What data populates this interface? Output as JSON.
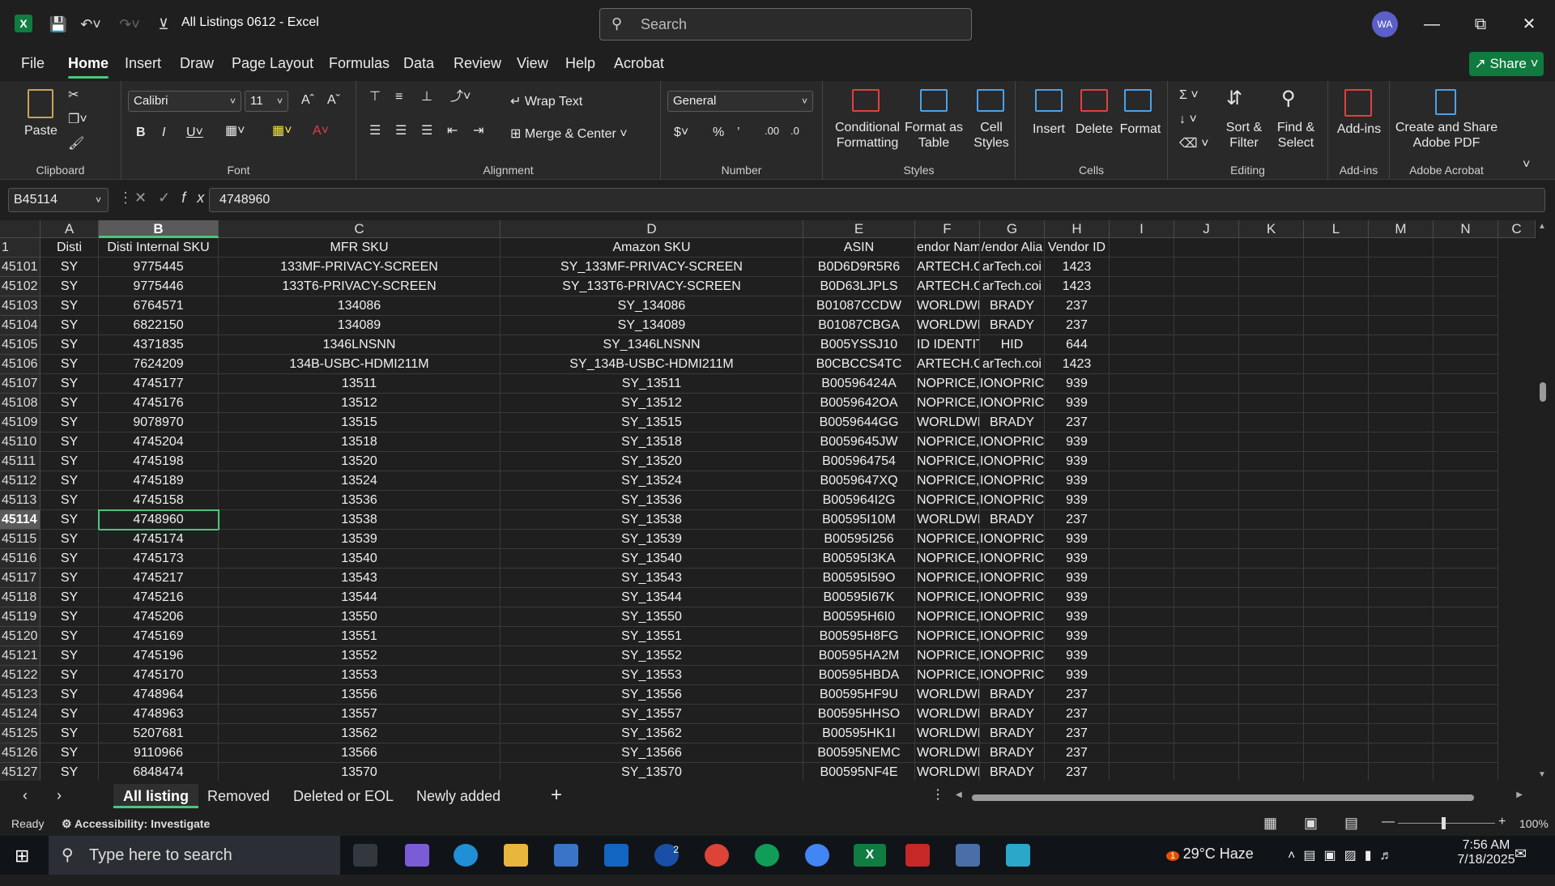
{
  "app": {
    "title": "All Listings 0612  -  Excel",
    "avatar_initials": "WA"
  },
  "search": {
    "placeholder": "Search"
  },
  "menu": {
    "items": [
      "File",
      "Home",
      "Insert",
      "Draw",
      "Page Layout",
      "Formulas",
      "Data",
      "Review",
      "View",
      "Help",
      "Acrobat"
    ],
    "active": "Home",
    "share": "Share"
  },
  "ribbon": {
    "clipboard": {
      "label": "Clipboard",
      "paste": "Paste"
    },
    "font": {
      "label": "Font",
      "name": "Calibri",
      "size": "11"
    },
    "alignment": {
      "label": "Alignment",
      "wrap": "Wrap Text",
      "merge": "Merge & Center"
    },
    "number": {
      "label": "Number",
      "format": "General"
    },
    "styles": {
      "label": "Styles",
      "conditional": "Conditional\nFormatting",
      "format_table": "Format as\nTable",
      "cell_styles": "Cell\nStyles"
    },
    "cells": {
      "label": "Cells",
      "insert": "Insert",
      "delete": "Delete",
      "format": "Format"
    },
    "editing": {
      "label": "Editing",
      "sort": "Sort &\nFilter",
      "find": "Find &\nSelect"
    },
    "addins": {
      "label": "Add-ins",
      "addins": "Add-ins"
    },
    "acrobat": {
      "label": "Adobe Acrobat",
      "create": "Create and Share\nAdobe PDF"
    }
  },
  "formula": {
    "namebox": "B45114",
    "value": "4748960"
  },
  "columns": [
    "A",
    "B",
    "C",
    "D",
    "E",
    "F",
    "G",
    "H",
    "I",
    "J",
    "K",
    "L",
    "M",
    "N",
    "C"
  ],
  "header_row": {
    "num": "1",
    "cells": [
      "Disti",
      "Disti Internal SKU",
      "MFR SKU",
      "Amazon SKU",
      "ASIN",
      "endor Nam",
      "/endor Alia",
      "Vendor ID"
    ]
  },
  "rows": [
    [
      "45101",
      "SY",
      "9775445",
      "133MF-PRIVACY-SCREEN",
      "SY_133MF-PRIVACY-SCREEN",
      "B0D6D9R5R6",
      "ARTECH.CC",
      "arTech.coi",
      "1423"
    ],
    [
      "45102",
      "SY",
      "9775446",
      "133T6-PRIVACY-SCREEN",
      "SY_133T6-PRIVACY-SCREEN",
      "B0D63LJPLS",
      "ARTECH.CC",
      "arTech.coi",
      "1423"
    ],
    [
      "45103",
      "SY",
      "6764571",
      "134086",
      "SY_134086",
      "B01087CCDW",
      "WORLDWII",
      "BRADY",
      "237"
    ],
    [
      "45104",
      "SY",
      "6822150",
      "134089",
      "SY_134089",
      "B01087CBGA",
      "WORLDWII",
      "BRADY",
      "237"
    ],
    [
      "45105",
      "SY",
      "4371835",
      "1346LNSNN",
      "SY_1346LNSNN",
      "B005YSSJ10",
      "ID IDENTIT",
      "HID",
      "644"
    ],
    [
      "45106",
      "SY",
      "7624209",
      "134B-USBC-HDMI211M",
      "SY_134B-USBC-HDMI211M",
      "B0CBCCS4TC",
      "ARTECH.CC",
      "arTech.coi",
      "1423"
    ],
    [
      "45107",
      "SY",
      "4745177",
      "13511",
      "SY_13511",
      "B00596424A",
      "NOPRICE, I",
      "IONOPRIC",
      "939"
    ],
    [
      "45108",
      "SY",
      "4745176",
      "13512",
      "SY_13512",
      "B0059642OA",
      "NOPRICE, I",
      "IONOPRIC",
      "939"
    ],
    [
      "45109",
      "SY",
      "9078970",
      "13515",
      "SY_13515",
      "B0059644GG",
      "WORLDWII",
      "BRADY",
      "237"
    ],
    [
      "45110",
      "SY",
      "4745204",
      "13518",
      "SY_13518",
      "B0059645JW",
      "NOPRICE, I",
      "IONOPRIC",
      "939"
    ],
    [
      "45111",
      "SY",
      "4745198",
      "13520",
      "SY_13520",
      "B005964754",
      "NOPRICE, I",
      "IONOPRIC",
      "939"
    ],
    [
      "45112",
      "SY",
      "4745189",
      "13524",
      "SY_13524",
      "B0059647XQ",
      "NOPRICE, I",
      "IONOPRIC",
      "939"
    ],
    [
      "45113",
      "SY",
      "4745158",
      "13536",
      "SY_13536",
      "B005964I2G",
      "NOPRICE, I",
      "IONOPRIC",
      "939"
    ],
    [
      "45114",
      "SY",
      "4748960",
      "13538",
      "SY_13538",
      "B00595I10M",
      "WORLDWII",
      "BRADY",
      "237"
    ],
    [
      "45115",
      "SY",
      "4745174",
      "13539",
      "SY_13539",
      "B00595I256",
      "NOPRICE, I",
      "IONOPRIC",
      "939"
    ],
    [
      "45116",
      "SY",
      "4745173",
      "13540",
      "SY_13540",
      "B00595I3KA",
      "NOPRICE, I",
      "IONOPRIC",
      "939"
    ],
    [
      "45117",
      "SY",
      "4745217",
      "13543",
      "SY_13543",
      "B00595I59O",
      "NOPRICE, I",
      "IONOPRIC",
      "939"
    ],
    [
      "45118",
      "SY",
      "4745216",
      "13544",
      "SY_13544",
      "B00595I67K",
      "NOPRICE, I",
      "IONOPRIC",
      "939"
    ],
    [
      "45119",
      "SY",
      "4745206",
      "13550",
      "SY_13550",
      "B00595H6I0",
      "NOPRICE, I",
      "IONOPRIC",
      "939"
    ],
    [
      "45120",
      "SY",
      "4745169",
      "13551",
      "SY_13551",
      "B00595H8FG",
      "NOPRICE, I",
      "IONOPRIC",
      "939"
    ],
    [
      "45121",
      "SY",
      "4745196",
      "13552",
      "SY_13552",
      "B00595HA2M",
      "NOPRICE, I",
      "IONOPRIC",
      "939"
    ],
    [
      "45122",
      "SY",
      "4745170",
      "13553",
      "SY_13553",
      "B00595HBDA",
      "NOPRICE, I",
      "IONOPRIC",
      "939"
    ],
    [
      "45123",
      "SY",
      "4748964",
      "13556",
      "SY_13556",
      "B00595HF9U",
      "WORLDWII",
      "BRADY",
      "237"
    ],
    [
      "45124",
      "SY",
      "4748963",
      "13557",
      "SY_13557",
      "B00595HHSO",
      "WORLDWII",
      "BRADY",
      "237"
    ],
    [
      "45125",
      "SY",
      "5207681",
      "13562",
      "SY_13562",
      "B00595HK1I",
      "WORLDWII",
      "BRADY",
      "237"
    ],
    [
      "45126",
      "SY",
      "9110966",
      "13566",
      "SY_13566",
      "B00595NEMC",
      "WORLDWII",
      "BRADY",
      "237"
    ],
    [
      "45127",
      "SY",
      "6848474",
      "13570",
      "SY_13570",
      "B00595NF4E",
      "WORLDWII",
      "BRADY",
      "237"
    ]
  ],
  "sheets": [
    "All listing",
    "Removed",
    "Deleted or EOL",
    "Newly added"
  ],
  "active_sheet": "All listing",
  "status": {
    "ready": "Ready",
    "accessibility": "Accessibility: Investigate",
    "zoom": "100%"
  },
  "taskbar": {
    "search_placeholder": "Type here to search",
    "weather": "29°C  Haze",
    "time": "7:56 AM",
    "date": "7/18/2025",
    "weather_badge": "1",
    "outlook_badge": "2"
  },
  "colors": {
    "accent": "#4ec57a",
    "excel_green": "#107c41",
    "background": "#1f1f1f"
  }
}
